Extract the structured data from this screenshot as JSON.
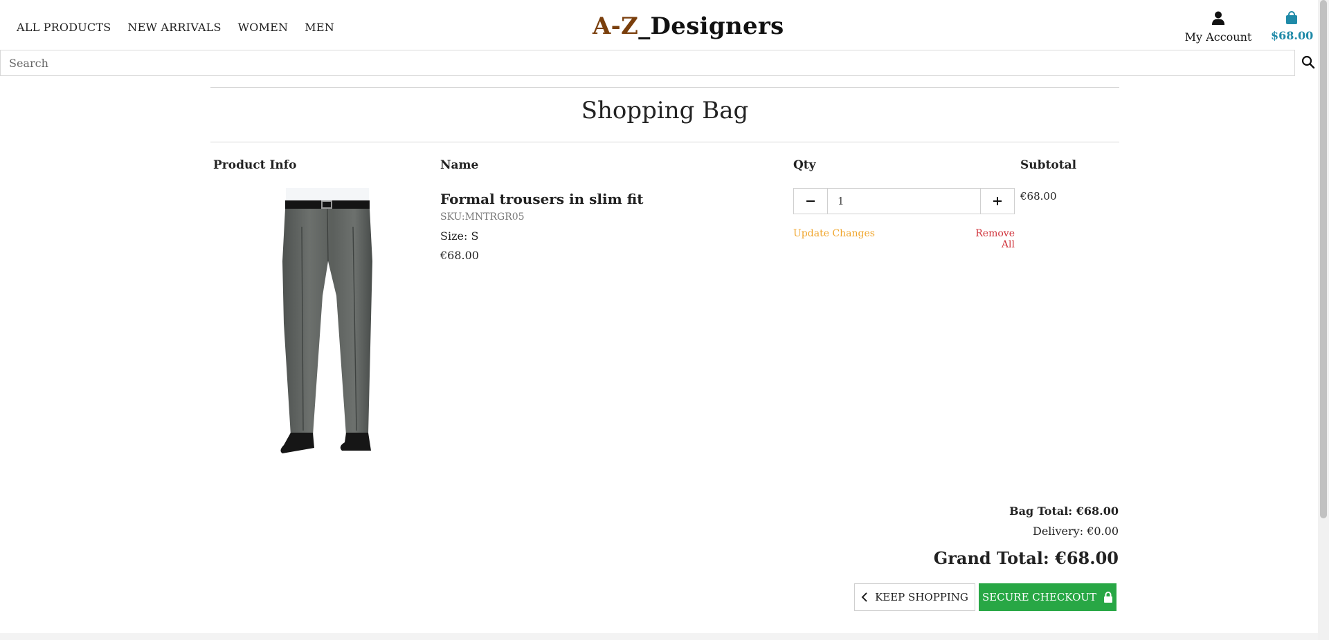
{
  "nav": {
    "items": [
      {
        "label": "ALL PRODUCTS"
      },
      {
        "label": "NEW ARRIVALS"
      },
      {
        "label": "WOMEN"
      },
      {
        "label": "MEN"
      }
    ]
  },
  "logo": {
    "accent": "A-Z",
    "rest": "_Designers"
  },
  "account": {
    "label": "My Account",
    "icon": "user-icon"
  },
  "bag": {
    "amount": "$68.00",
    "icon": "shopping-bag-icon",
    "color": "#1f8aa8"
  },
  "search": {
    "placeholder": "Search",
    "value": "",
    "icon": "search-icon"
  },
  "page": {
    "title": "Shopping Bag"
  },
  "table": {
    "headers": {
      "product_info": "Product Info",
      "name": "Name",
      "qty": "Qty",
      "subtotal": "Subtotal"
    }
  },
  "item": {
    "name": "Formal trousers in slim fit",
    "sku": "SKU:MNTRGR05",
    "size": "Size: S",
    "price": "€68.00",
    "qty": "1",
    "subtotal": "€68.00",
    "update_label": "Update Changes",
    "remove_label": "Remove All"
  },
  "totals": {
    "bag_total": "Bag Total: €68.00",
    "delivery": "Delivery: €0.00",
    "grand_total": "Grand Total: €68.00"
  },
  "buttons": {
    "keep_shopping": "KEEP SHOPPING",
    "checkout": "SECURE CHECKOUT"
  },
  "colors": {
    "logo_accent": "#7a3f0c",
    "update": "#f0a52b",
    "remove": "#d0343c",
    "checkout": "#28a745"
  }
}
